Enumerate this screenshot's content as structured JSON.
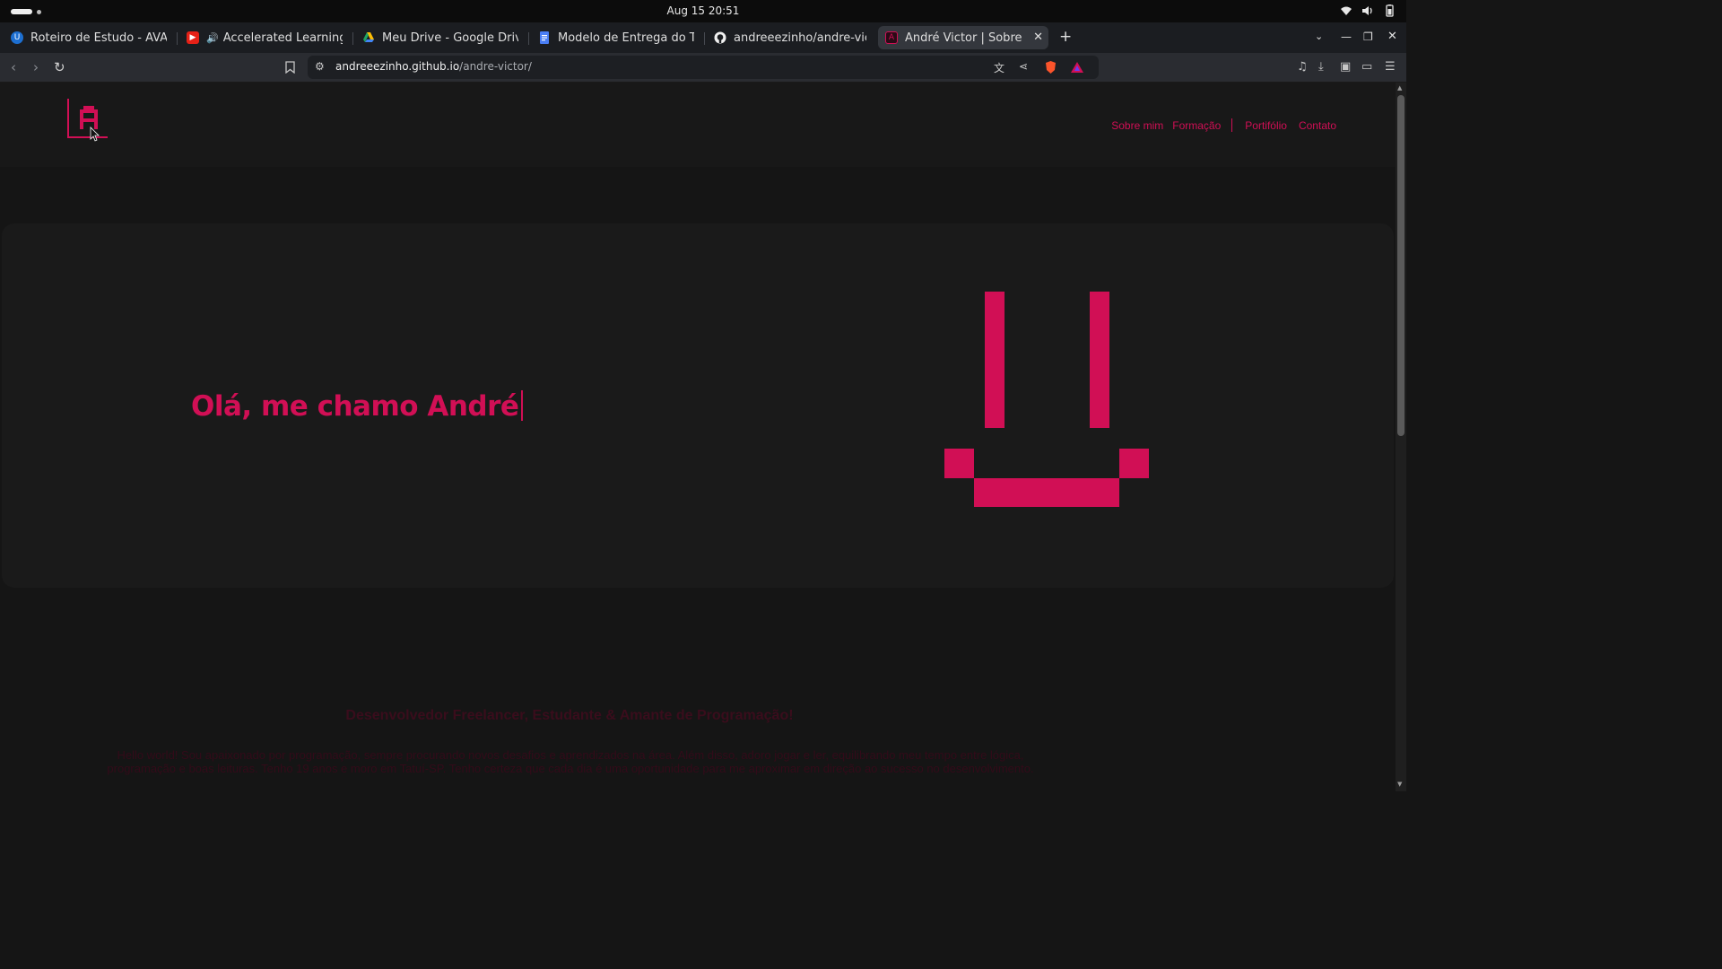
{
  "os": {
    "clock": "Aug 15  20:51",
    "tray_icons": [
      "wifi-icon",
      "volume-icon",
      "battery-icon"
    ]
  },
  "browser": {
    "tabs": [
      {
        "label": "Roteiro de Estudo - AVA UNI",
        "favicon": "ava-icon",
        "favicon_color": "#1d6fd1"
      },
      {
        "label": "Accelerated Learning - Ga",
        "favicon": "youtube-icon",
        "favicon_color": "#e62117",
        "audio": true
      },
      {
        "label": "Meu Drive - Google Drive",
        "favicon": "google-drive-icon",
        "favicon_color": "#fbbc04"
      },
      {
        "label": "Modelo de Entrega do Traba",
        "favicon": "google-docs-icon",
        "favicon_color": "#4a7ef5"
      },
      {
        "label": "andreeezinho/andre-victor:",
        "favicon": "github-icon",
        "favicon_color": "#ffffff"
      },
      {
        "label": "André Victor | Sobre mim",
        "favicon": "site-icon",
        "favicon_color": "#d10f55",
        "active": true
      }
    ],
    "new_tab_label": "+",
    "url_host": "andreeezinho.github.io",
    "url_path": "/andre-victor/"
  },
  "site": {
    "nav": {
      "about": "Sobre mim",
      "education": "Formação",
      "portfolio": "Portifólio",
      "contact": "Contato"
    },
    "hero_title": "Olá, me chamo André",
    "subtitle": "Desenvolvedor Freelancer, Estudante & Amante de Programação!",
    "bio": "Hello world! Sou apaixonado por programação, sempre procurando novos desafios e aprendizados na área. Além disso, adoro jogar e ler, equilibrando meu tempo entre lógica, programação e boas leituras. Tenho 19 anos e moro em Tatuí-SP. Tenho certeza que cada dia é uma oportunidade para me aproximar em direção ao sucesso no desenvolvimento."
  },
  "colors": {
    "accent": "#d10f55",
    "page_bg": "#151515",
    "hero_bg": "#1a1a1a"
  }
}
